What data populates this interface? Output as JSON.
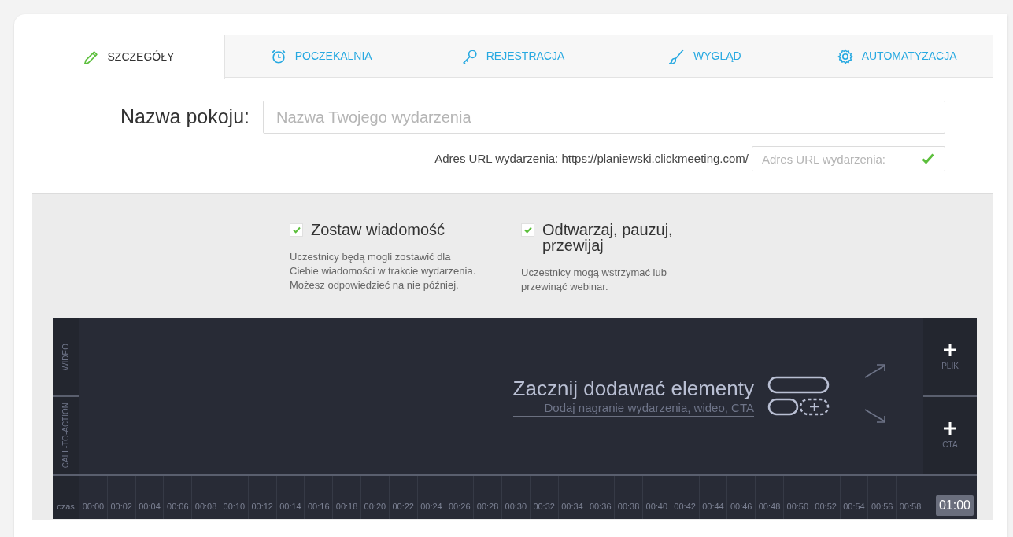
{
  "tabs": [
    {
      "label": "SZCZEGÓŁY",
      "kind": "pencil",
      "selected": true
    },
    {
      "label": "POCZEKALNIA",
      "kind": "alarm",
      "selected": false
    },
    {
      "label": "REJESTRACJA",
      "kind": "key",
      "selected": false
    },
    {
      "label": "WYGLĄD",
      "kind": "brush",
      "selected": false
    },
    {
      "label": "AUTOMATYZACJA",
      "kind": "gear",
      "selected": false
    }
  ],
  "room_name": {
    "label": "Nazwa pokoju:",
    "placeholder": "Nazwa Twojego wydarzenia"
  },
  "event_url": {
    "label": "Adres URL wydarzenia: https://planiewski.clickmeeting.com/",
    "placeholder": "Adres URL wydarzenia:",
    "valid": true
  },
  "options": [
    {
      "title": "Zostaw wiadomość",
      "checked": true,
      "description": "Uczestnicy będą mogli zostawić dla Ciebie wiadomości w trakcie wydarzenia. Możesz odpowiedzieć na nie później."
    },
    {
      "title": "Odtwarzaj, pauzuj, przewijaj",
      "checked": true,
      "description": "Uczestnicy mogą wstrzymać lub przewinąć webinar."
    }
  ],
  "timeline": {
    "tracks": [
      "WIDEO",
      "CALL-TO-ACTION"
    ],
    "empty_title": "Zacznij dodawać elementy",
    "empty_link": "Dodaj nagranie wydarzenia, wideo, CTA",
    "add_buttons": [
      "PLIK",
      "CTA"
    ],
    "time_label": "czas",
    "ticks": [
      "00:00",
      "00:02",
      "00:04",
      "00:06",
      "00:08",
      "00:10",
      "00:12",
      "00:14",
      "00:16",
      "00:18",
      "00:20",
      "00:22",
      "00:24",
      "00:26",
      "00:28",
      "00:30",
      "00:32",
      "00:34",
      "00:36",
      "00:38",
      "00:40",
      "00:42",
      "00:44",
      "00:46",
      "00:48",
      "00:50",
      "00:52",
      "00:54",
      "00:56",
      "00:58"
    ],
    "end_time": "01:00"
  }
}
